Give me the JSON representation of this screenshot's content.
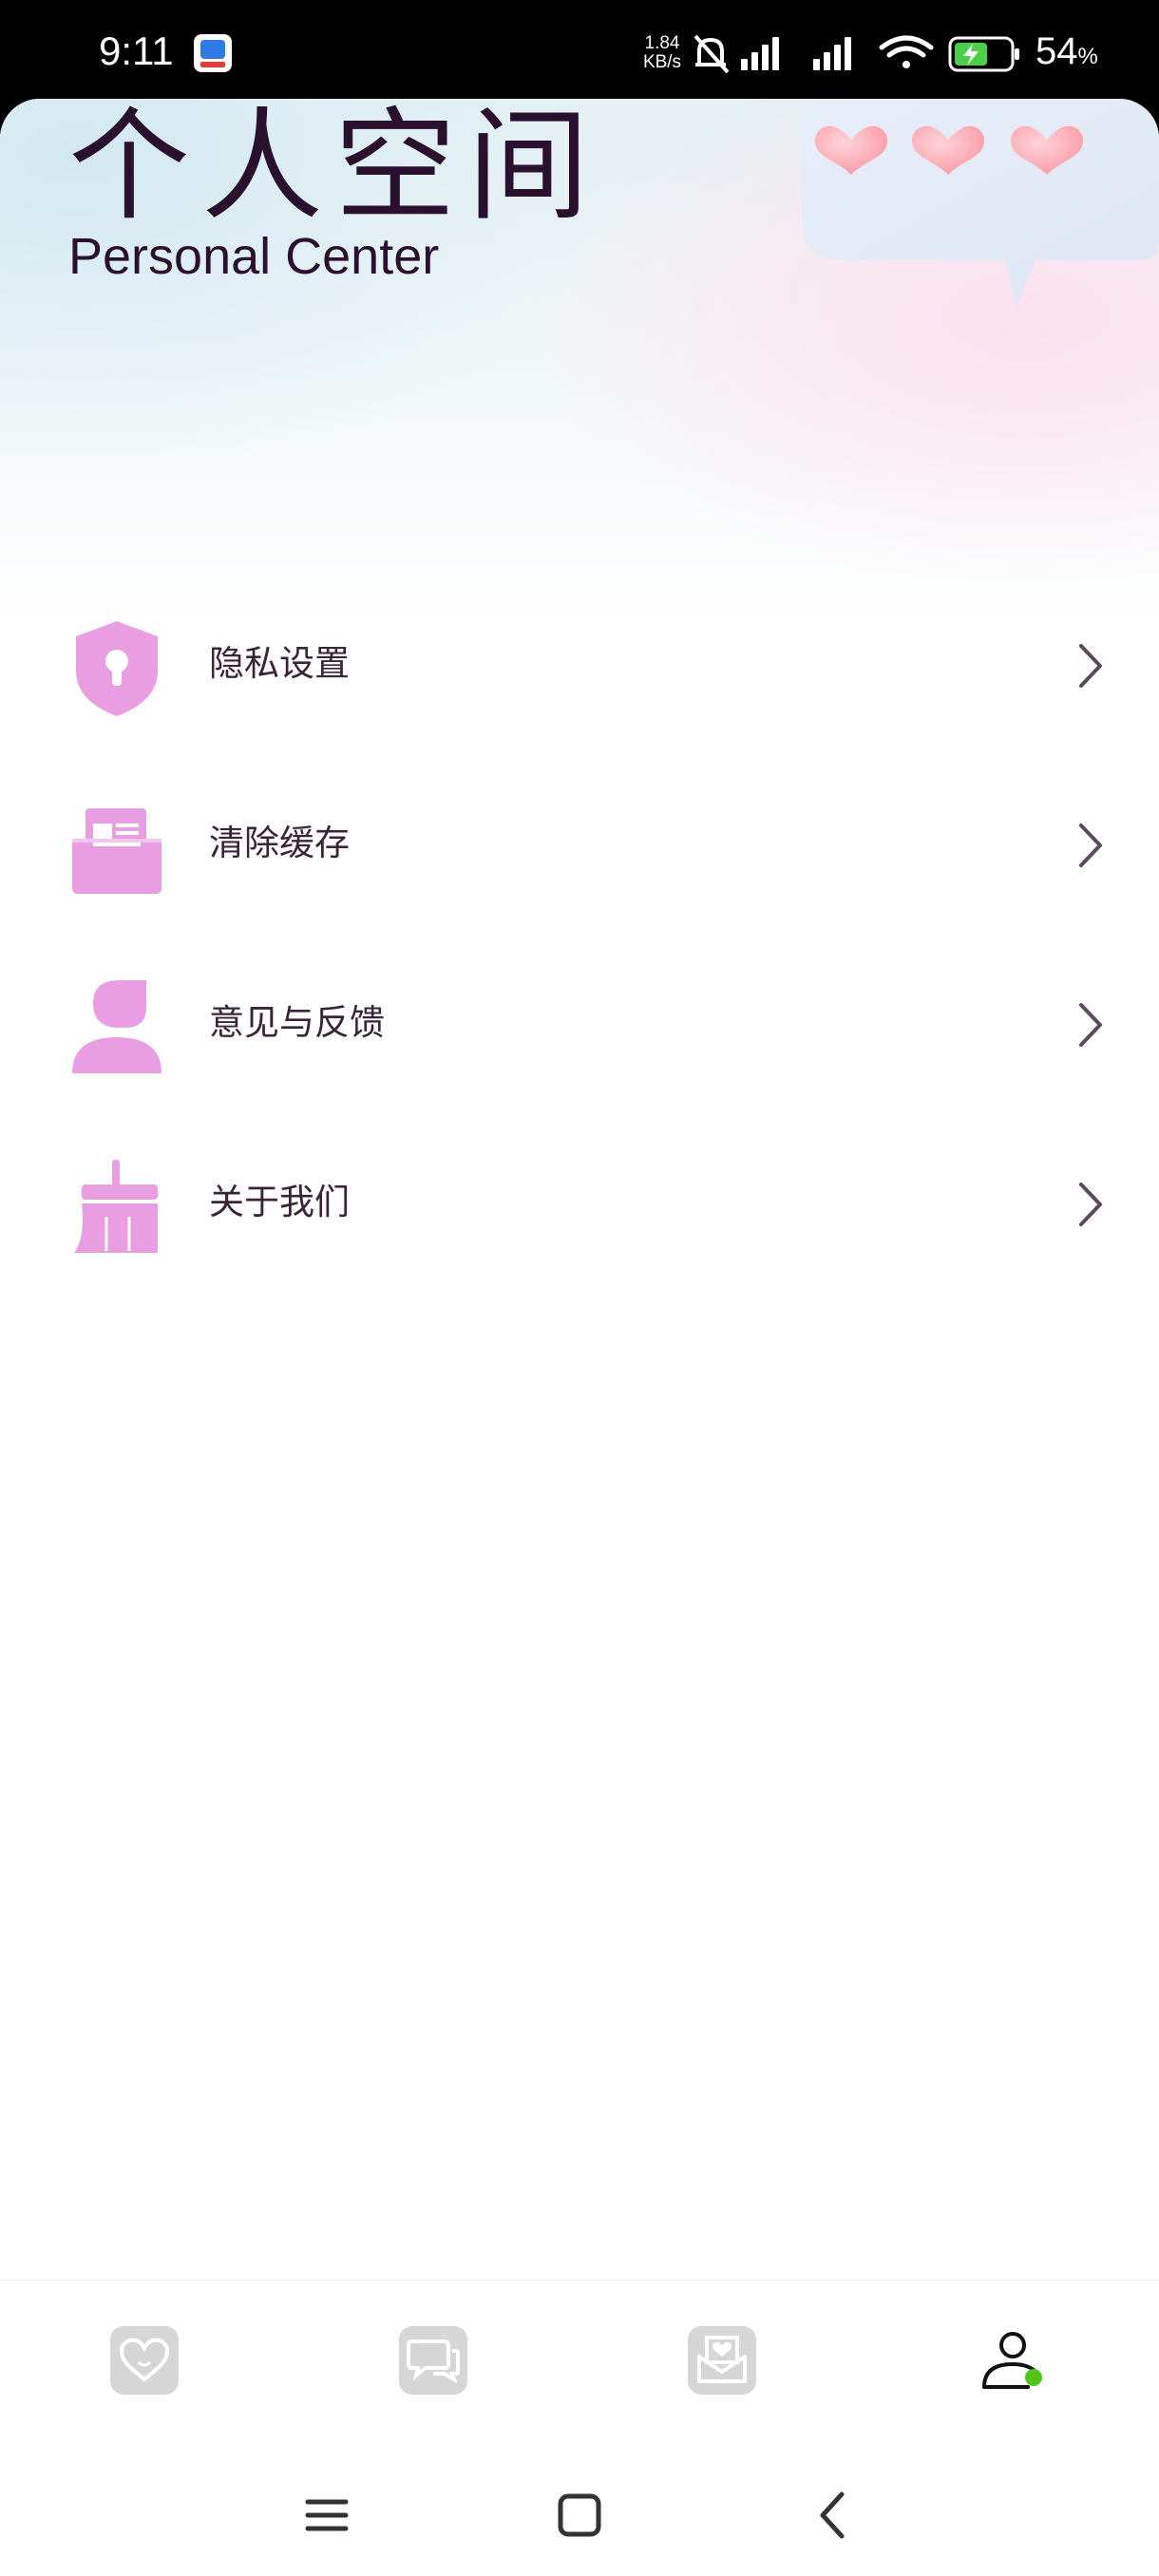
{
  "status_bar": {
    "time": "9:11",
    "net_speed_value": "1.84",
    "net_speed_unit": "KB/s",
    "battery_percent": "54",
    "battery_unit": "%",
    "icons": [
      "app-notification-icon",
      "mute-icon",
      "signal-1-icon",
      "signal-2-icon",
      "wifi-icon",
      "battery-charging-icon"
    ]
  },
  "header": {
    "title": "个人空间",
    "subtitle": "Personal Center",
    "decoration": "speech-bubble-hearts"
  },
  "menu": {
    "items": [
      {
        "label": "隐私设置",
        "icon": "privacy-shield-icon"
      },
      {
        "label": "清除缓存",
        "icon": "clear-cache-icon"
      },
      {
        "label": "意见与反馈",
        "icon": "feedback-icon"
      },
      {
        "label": "关于我们",
        "icon": "about-us-icon"
      }
    ],
    "icon_color": "#e89ee0",
    "chevron_color": "#5a4a5a"
  },
  "bottom_nav": {
    "tabs": [
      {
        "icon": "heart-tab-icon",
        "active": false
      },
      {
        "icon": "chat-tab-icon",
        "active": false
      },
      {
        "icon": "mail-heart-tab-icon",
        "active": false
      },
      {
        "icon": "profile-tab-icon",
        "active": true
      }
    ],
    "inactive_color": "#d6d6d6",
    "active_color": "#111111",
    "active_dot_color": "#52c41a"
  },
  "system_nav": {
    "buttons": [
      "menu-icon",
      "home-icon",
      "back-icon"
    ]
  }
}
